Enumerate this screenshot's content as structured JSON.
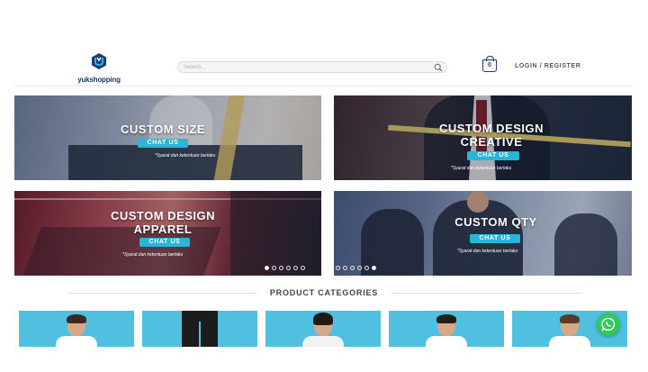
{
  "header": {
    "logo_text": "yukshopping",
    "search_placeholder": "Search...",
    "cart_count": "0",
    "login_label": "LOGIN / REGISTER"
  },
  "banners": [
    {
      "title": "CUSTOM SIZE",
      "button": "CHAT US",
      "note": "*Syarat dan ketentuan berlaku"
    },
    {
      "title_line1": "CUSTOM DESIGN",
      "title_line2": "CREATIVE",
      "button": "CHAT US",
      "note": "*Syarat dan ketentuan berlaku"
    },
    {
      "title_line1": "CUSTOM DESIGN",
      "title_line2": "APPAREL",
      "button": "CHAT US",
      "note": "*Syarat dan ketentuan berlaku"
    },
    {
      "title": "CUSTOM QTY",
      "button": "CHAT US",
      "note": "*Syarat dan ketentuan berlaku"
    }
  ],
  "slider_left": {
    "dots": 6,
    "active_index": 0
  },
  "slider_right": {
    "dots": 6,
    "active_index": 5
  },
  "categories": {
    "heading": "PRODUCT CATEGORIES"
  },
  "colors": {
    "brand": "#1f3b75",
    "accent": "#29b5d9",
    "category_bg": "#4fc0e0",
    "whatsapp": "#2fc85b"
  },
  "icons": [
    "logo-icon",
    "search-icon",
    "cart-icon",
    "whatsapp-icon"
  ]
}
